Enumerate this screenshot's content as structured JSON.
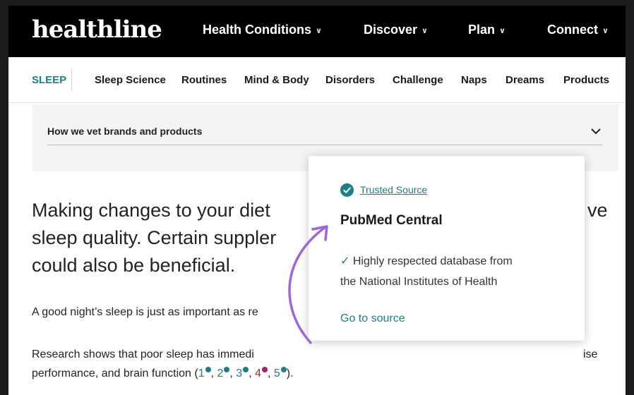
{
  "header": {
    "logo": "healthline",
    "nav": [
      "Health Conditions",
      "Discover",
      "Plan",
      "Connect"
    ]
  },
  "subnav": {
    "active": "SLEEP",
    "items": [
      "Sleep Science",
      "Routines",
      "Mind & Body",
      "Disorders",
      "Challenge",
      "Naps",
      "Dreams",
      "Products"
    ]
  },
  "vet": {
    "title": "How we vet brands and products"
  },
  "article": {
    "lead": "Making changes to your diet or taking supplements may help improve sleep quality. Certain supplements could also be beneficial.",
    "lead_lines": [
      "Making changes to your diet",
      "ve",
      "sleep quality. Certain suppler",
      "could also be beneficial."
    ],
    "para1": "A good night’s sleep is just as important as re",
    "para2_line1_a": "Research shows that poor sleep has immedi",
    "para2_line1_b": "ise",
    "para2_line2_prefix": "performance, and brain function (",
    "citations": [
      "1",
      "2",
      "3",
      "4",
      "5"
    ],
    "para2_line2_suffix": ")."
  },
  "popover": {
    "trusted_label": "Trusted Source",
    "source_name": "PubMed Central",
    "tick": "✓",
    "description_line1": "Highly respected database from",
    "description_line2": "the National Institutes of Health",
    "link": "Go to source"
  },
  "colors": {
    "teal": "#1b7f86",
    "magenta": "#a61e6a",
    "arrow": "#a066d9"
  }
}
